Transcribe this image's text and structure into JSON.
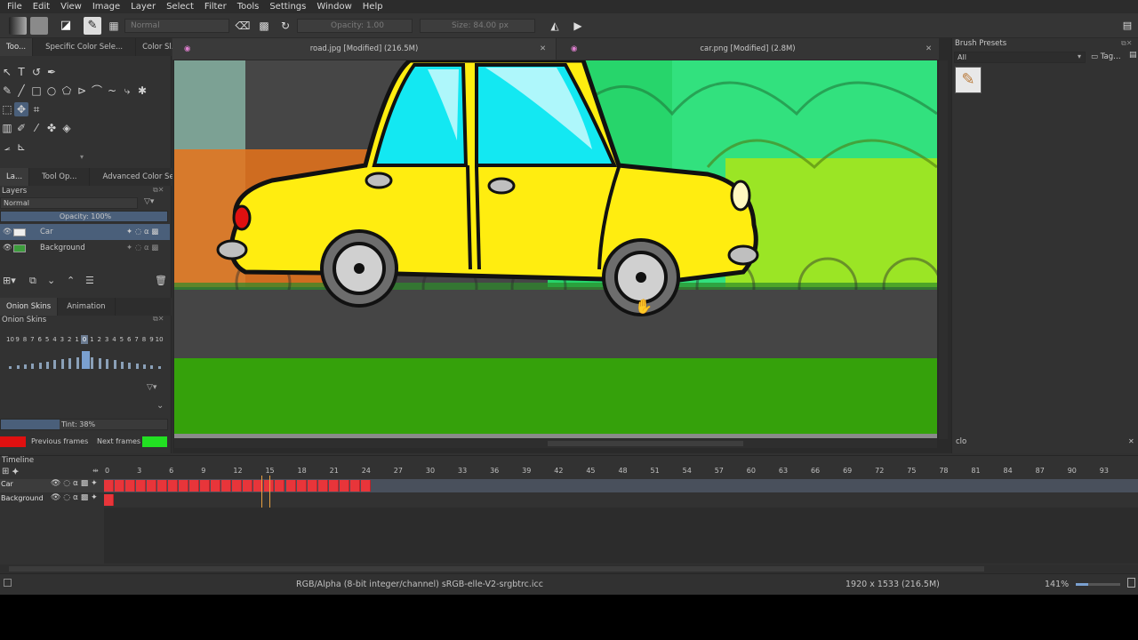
{
  "menubar": [
    "File",
    "Edit",
    "View",
    "Image",
    "Layer",
    "Select",
    "Filter",
    "Tools",
    "Settings",
    "Window",
    "Help"
  ],
  "toolbar": {
    "blend_mode": "Normal",
    "opacity": "Opacity:  1.00",
    "size": "Size:  84.00 px"
  },
  "left_top_tabs": [
    "Too...",
    "Specific Color Sele...",
    "Color Sl..."
  ],
  "left_mid_tabs": [
    "La...",
    "Tool Op...",
    "Advanced Color Sel..."
  ],
  "layers": {
    "title": "Layers",
    "blend": "Normal",
    "opacity": "Opacity:  100%",
    "items": [
      {
        "name": "Car",
        "selected": true
      },
      {
        "name": "Background",
        "selected": false
      }
    ]
  },
  "onion": {
    "tabs": [
      "Onion Skins",
      "Animation"
    ],
    "title": "Onion Skins",
    "numbers": [
      "10",
      "9",
      "8",
      "7",
      "6",
      "5",
      "4",
      "3",
      "2",
      "1",
      "0",
      "1",
      "2",
      "3",
      "4",
      "5",
      "6",
      "7",
      "8",
      "9",
      "10"
    ],
    "tint": "Tint: 38%",
    "prev_label": "Previous frames",
    "next_label": "Next frames",
    "prev_color": "#e01010",
    "next_color": "#22e022"
  },
  "documents": [
    {
      "title": "road.jpg [Modified]  (216.5M)"
    },
    {
      "title": "car.png [Modified]  (2.8M)"
    }
  ],
  "brush_presets": {
    "title": "Brush Presets",
    "filter": "All",
    "tag": "Tag",
    "search": "clo"
  },
  "timeline": {
    "title": "Timeline",
    "ticks": [
      "0",
      "3",
      "6",
      "9",
      "12",
      "15",
      "18",
      "21",
      "24",
      "27",
      "30",
      "33",
      "36",
      "39",
      "42",
      "45",
      "48",
      "51",
      "54",
      "57",
      "60",
      "63",
      "66",
      "69",
      "72",
      "75",
      "78",
      "81",
      "84",
      "87",
      "90",
      "93"
    ],
    "layers": [
      "Car",
      "Background"
    ],
    "current_frame": 15,
    "car_frames": 25,
    "background_frames": 1
  },
  "status": {
    "color_profile": "RGB/Alpha (8-bit integer/channel)  sRGB-elle-V2-srgbtrc.icc",
    "dimensions": "1920 x 1533 (216.5M)",
    "zoom": "141%"
  },
  "colors": {
    "frame_red": "#e8353a",
    "playhead": "#e8a040",
    "selection": "#4a5f7a"
  }
}
